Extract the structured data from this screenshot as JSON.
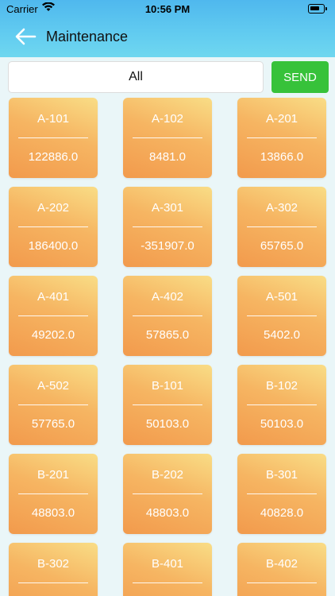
{
  "status_bar": {
    "carrier": "Carrier",
    "time": "10:56 PM"
  },
  "header": {
    "title": "Maintenance",
    "back_icon": "arrow-left-icon"
  },
  "filter": {
    "value": "All"
  },
  "send_button": {
    "label": "SEND",
    "color": "#37c23a"
  },
  "units": [
    {
      "name": "A-101",
      "value": "122886.0"
    },
    {
      "name": "A-102",
      "value": "8481.0"
    },
    {
      "name": "A-201",
      "value": "13866.0"
    },
    {
      "name": "A-202",
      "value": "186400.0"
    },
    {
      "name": "A-301",
      "value": "-351907.0"
    },
    {
      "name": "A-302",
      "value": "65765.0"
    },
    {
      "name": "A-401",
      "value": "49202.0"
    },
    {
      "name": "A-402",
      "value": "57865.0"
    },
    {
      "name": "A-501",
      "value": "5402.0"
    },
    {
      "name": "A-502",
      "value": "57765.0"
    },
    {
      "name": "B-101",
      "value": "50103.0"
    },
    {
      "name": "B-102",
      "value": "50103.0"
    },
    {
      "name": "B-201",
      "value": "48803.0"
    },
    {
      "name": "B-202",
      "value": "48803.0"
    },
    {
      "name": "B-301",
      "value": "40828.0"
    },
    {
      "name": "B-302",
      "value": ""
    },
    {
      "name": "B-401",
      "value": ""
    },
    {
      "name": "B-402",
      "value": ""
    }
  ],
  "colors": {
    "header_gradient_start": "#4fb8ee",
    "header_gradient_end": "#6fd7ef",
    "card_gradient_top": "#f9dd86",
    "card_gradient_bottom": "#f29a4c",
    "background": "#eaf6f8"
  }
}
